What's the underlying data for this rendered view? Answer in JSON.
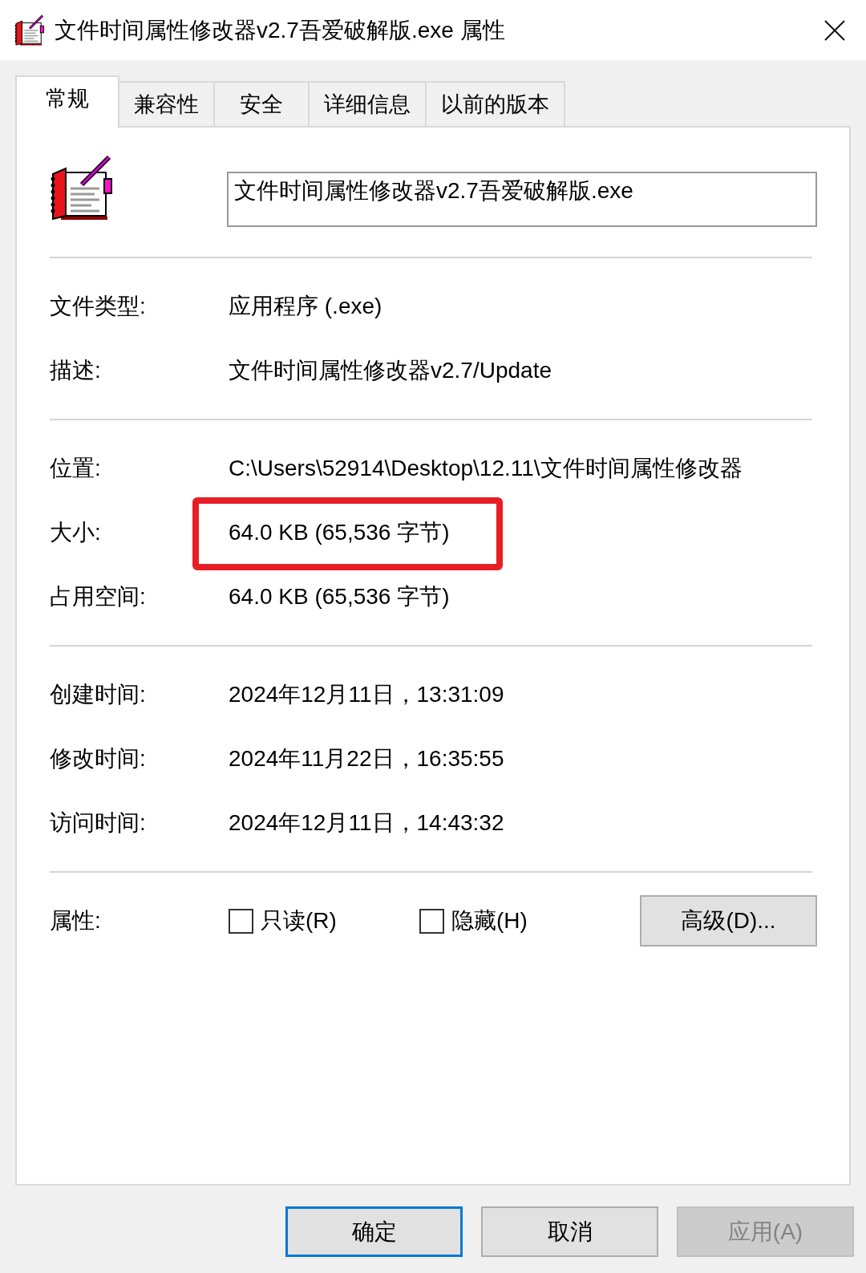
{
  "window": {
    "title": "文件时间属性修改器v2.7吾爱破解版.exe 属性"
  },
  "tabs": [
    {
      "label": "常规",
      "selected": true
    },
    {
      "label": "兼容性",
      "selected": false
    },
    {
      "label": "安全",
      "selected": false
    },
    {
      "label": "详细信息",
      "selected": false
    },
    {
      "label": "以前的版本",
      "selected": false
    }
  ],
  "file_name": {
    "value": "文件时间属性修改器v2.7吾爱破解版.exe"
  },
  "sections": [
    {
      "rows": [
        {
          "label": "文件类型:",
          "value": "应用程序 (.exe)",
          "highlighted": false
        },
        {
          "label": "描述:",
          "value": "文件时间属性修改器v2.7/Update",
          "highlighted": false
        }
      ]
    },
    {
      "rows": [
        {
          "label": "位置:",
          "value": "C:\\Users\\52914\\Desktop\\12.11\\文件时间属性修改器",
          "highlighted": false
        },
        {
          "label": "大小:",
          "value": "64.0 KB (65,536 字节)",
          "highlighted": true
        },
        {
          "label": "占用空间:",
          "value": "64.0 KB (65,536 字节)",
          "highlighted": false
        }
      ]
    },
    {
      "rows": [
        {
          "label": "创建时间:",
          "value": "2024年12月11日，13:31:09",
          "highlighted": false
        },
        {
          "label": "修改时间:",
          "value": "2024年11月22日，16:35:55",
          "highlighted": false
        },
        {
          "label": "访问时间:",
          "value": "2024年12月11日，14:43:32",
          "highlighted": false
        }
      ]
    }
  ],
  "attributes": {
    "label": "属性:",
    "checkboxes": [
      {
        "label": "只读(R)",
        "checked": false
      },
      {
        "label": "隐藏(H)",
        "checked": false
      }
    ],
    "advanced_button": "高级(D)..."
  },
  "buttons": [
    {
      "label": "确定",
      "default": true,
      "disabled": false
    },
    {
      "label": "取消",
      "default": false,
      "disabled": false
    },
    {
      "label": "应用(A)",
      "default": false,
      "disabled": true
    }
  ]
}
